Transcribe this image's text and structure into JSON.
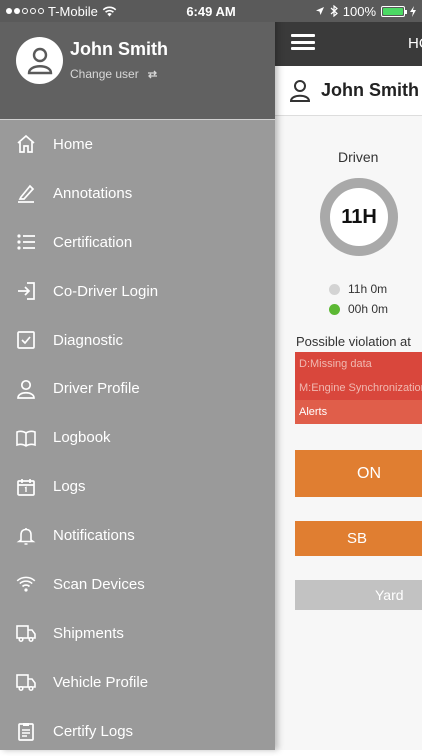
{
  "statusbar": {
    "carrier": "T-Mobile",
    "time": "6:49 AM",
    "battery": "100%"
  },
  "drawer": {
    "user_name": "John Smith",
    "change_user": "Change user",
    "items": [
      {
        "label": "Home",
        "icon": "home-icon"
      },
      {
        "label": "Annotations",
        "icon": "pencil-icon"
      },
      {
        "label": "Certification",
        "icon": "list-icon"
      },
      {
        "label": "Co-Driver Login",
        "icon": "login-icon"
      },
      {
        "label": "Diagnostic",
        "icon": "checkbox-icon"
      },
      {
        "label": "Driver Profile",
        "icon": "user-icon"
      },
      {
        "label": "Logbook",
        "icon": "book-icon"
      },
      {
        "label": "Logs",
        "icon": "calendar-icon"
      },
      {
        "label": "Notifications",
        "icon": "bell-icon"
      },
      {
        "label": "Scan Devices",
        "icon": "wifi-icon"
      },
      {
        "label": "Shipments",
        "icon": "truck-icon"
      },
      {
        "label": "Vehicle Profile",
        "icon": "truck-icon"
      },
      {
        "label": "Certify Logs",
        "icon": "clipboard-icon"
      }
    ]
  },
  "app": {
    "title": "HO",
    "user_name": "John Smith",
    "driven_label": "Driven",
    "ring_value": "11H",
    "legend": [
      {
        "label": "11h 0m",
        "color": "#d3d3d3"
      },
      {
        "label": "00h 0m",
        "color": "#5cb833"
      }
    ],
    "violation_text": "Possible violation at",
    "alerts": [
      "D:Missing data",
      "M:Engine Synchronization",
      "Alerts"
    ],
    "buttons": {
      "on": "ON",
      "sb": "SB",
      "yard": "Yard"
    }
  }
}
